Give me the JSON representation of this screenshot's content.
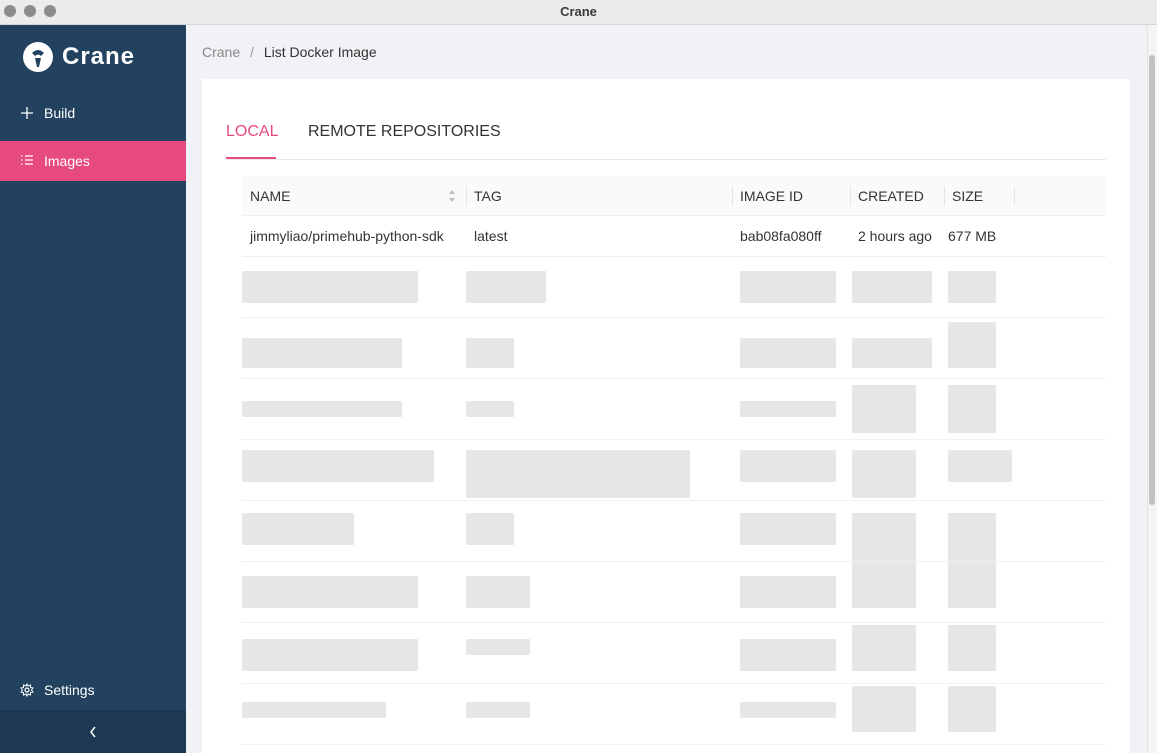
{
  "window": {
    "title": "Crane"
  },
  "app": {
    "name": "Crane"
  },
  "sidebar": {
    "items": [
      {
        "label": "Build",
        "icon": "plus-icon"
      },
      {
        "label": "Images",
        "icon": "list-icon",
        "active": true
      }
    ],
    "settings_label": "Settings",
    "collapse_icon": "chevron-left-icon"
  },
  "breadcrumb": {
    "root": "Crane",
    "separator": "/",
    "current": "List Docker Image"
  },
  "tabs": [
    {
      "label": "LOCAL",
      "active": true
    },
    {
      "label": "REMOTE REPOSITORIES",
      "active": false
    }
  ],
  "table": {
    "columns": [
      "NAME",
      "TAG",
      "IMAGE ID",
      "CREATED",
      "SIZE"
    ],
    "rows": [
      {
        "name": "jimmyliao/primehub-python-sdk",
        "tag": "latest",
        "image_id": "bab08fa080ff",
        "created": "2 hours ago",
        "size": "677 MB"
      }
    ]
  },
  "colors": {
    "accent": "#e64a7e",
    "sidebar_bg": "#22425f"
  }
}
